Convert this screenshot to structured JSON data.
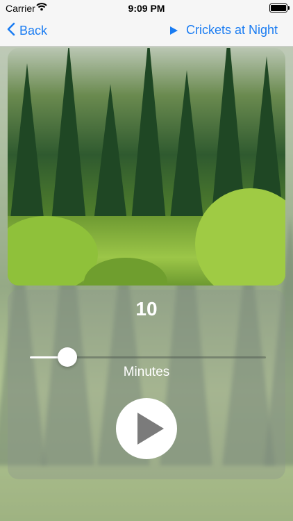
{
  "status_bar": {
    "carrier": "Carrier",
    "time": "9:09 PM"
  },
  "nav": {
    "back_label": "Back",
    "title": "Crickets at Night"
  },
  "timer": {
    "value": "10",
    "unit": "Minutes",
    "slider_fraction": 0.1
  },
  "colors": {
    "accent": "#1a7cf2"
  },
  "icons": {
    "back": "chevron-left-icon",
    "title": "play-small-icon",
    "play": "play-icon",
    "wifi": "wifi-icon",
    "battery": "battery-icon"
  }
}
